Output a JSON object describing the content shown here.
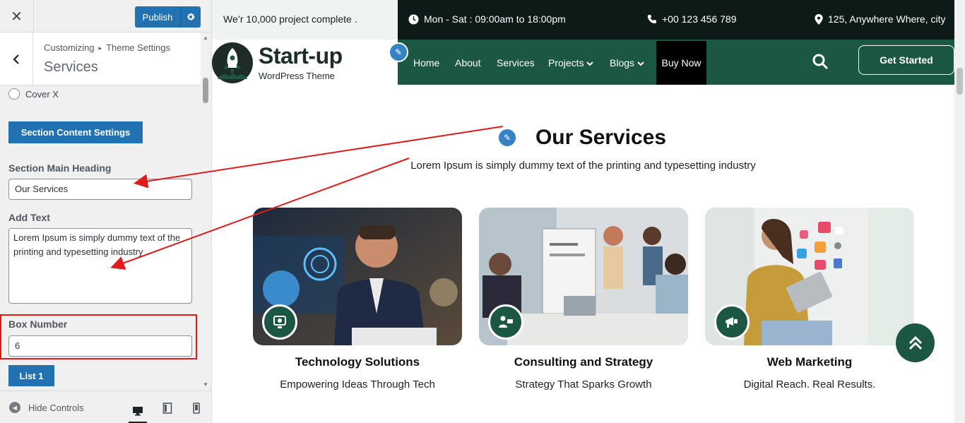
{
  "customizer": {
    "close_label": "✕",
    "publish_label": "Publish",
    "breadcrumb": {
      "root": "Customizing",
      "section": "Theme Settings"
    },
    "panel_title": "Services",
    "radio_option": "Cover X",
    "section_content_button": "Section Content Settings",
    "fields": {
      "main_heading_label": "Section Main Heading",
      "main_heading_value": "Our Services",
      "add_text_label": "Add Text",
      "add_text_value": "Lorem Ipsum is simply dummy text of the printing and typesetting industry",
      "box_number_label": "Box Number",
      "box_number_value": "6"
    },
    "list_button": "List 1",
    "footer": {
      "hide_controls": "Hide Controls"
    },
    "devices": [
      "desktop",
      "tablet",
      "mobile"
    ],
    "active_device": "desktop"
  },
  "site": {
    "topbar": {
      "announcement": "We’r 10,000 project complete .",
      "hours": "Mon - Sat : 09:00am to 18:00pm",
      "phone": "+00 123 456 789",
      "address": "125, Anywhere Where, city"
    },
    "logo": {
      "title": "Start-up",
      "subtitle": "WordPress Theme"
    },
    "nav": {
      "home": "Home",
      "about": "About",
      "services": "Services",
      "projects": "Projects",
      "blogs": "Blogs",
      "buy_now": "Buy Now"
    },
    "cta": "Get Started",
    "services": {
      "heading": "Our Services",
      "subheading": "Lorem Ipsum is simply dummy text of the printing and typesetting industry",
      "cards": [
        {
          "title": "Technology Solutions",
          "desc": "Empowering Ideas Through Tech"
        },
        {
          "title": "Consulting and Strategy",
          "desc": "Strategy That Sparks Growth"
        },
        {
          "title": "Web Marketing",
          "desc": "Digital Reach. Real Results."
        }
      ]
    }
  },
  "colors": {
    "wp_blue": "#2271b1",
    "brand_green": "#1b5743",
    "topbar_dark": "#0e1a17",
    "annotation_red": "#e01b1b"
  }
}
